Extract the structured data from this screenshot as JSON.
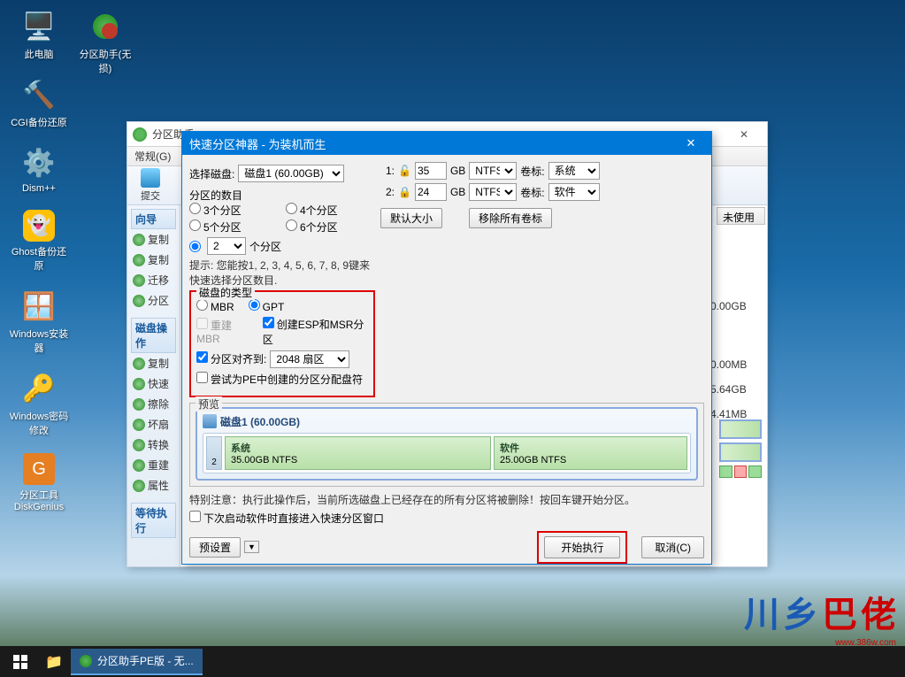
{
  "desktop": {
    "icons": [
      {
        "name": "this-pc",
        "label": "此电脑",
        "glyph": "🖥️"
      },
      {
        "name": "partition-assistant",
        "label": "分区助手(无损)",
        "glyph": "💿"
      },
      {
        "name": "cgi-backup",
        "label": "CGI备份还原",
        "glyph": "🔨"
      },
      {
        "name": "dism",
        "label": "Dism++",
        "glyph": "⚙️"
      },
      {
        "name": "ghost",
        "label": "Ghost备份还原",
        "glyph": "👻"
      },
      {
        "name": "windows-installer",
        "label": "Windows安装器",
        "glyph": "🪟"
      },
      {
        "name": "windows-password",
        "label": "Windows密码修改",
        "glyph": "🔑"
      },
      {
        "name": "diskgenius",
        "label": "分区工具DiskGenius",
        "glyph": "💾"
      }
    ]
  },
  "parent_window": {
    "title": "分区助手",
    "menu": {
      "general": "常规(G)"
    },
    "toolbar": {
      "submit": "提交"
    },
    "sidebar": {
      "wizard_title": "向导",
      "wizard_items": [
        "复制",
        "复制",
        "迁移",
        "分区"
      ],
      "disk_title": "磁盘操作",
      "disk_items": [
        "复制",
        "快速",
        "擦除",
        "坏扇",
        "转换",
        "重建",
        "属性"
      ],
      "pending_title": "等待执行"
    },
    "col_unused": "未使用",
    "info_rows": [
      "0.00GB",
      "0.00MB",
      "5.64GB",
      "4.41MB"
    ]
  },
  "dialog": {
    "title": "快速分区神器 - 为装机而生",
    "select_disk_label": "选择磁盘:",
    "select_disk_value": "磁盘1 (60.00GB)",
    "partition_count": {
      "label": "分区的数目",
      "opts": {
        "p3": "3个分区",
        "p4": "4个分区",
        "p5": "5个分区",
        "p6": "6个分区"
      },
      "custom_count": "2",
      "custom_unit": "个分区",
      "hint": "提示: 您能按1, 2, 3, 4, 5, 6, 7, 8, 9键来快速选择分区数目."
    },
    "disk_type": {
      "legend": "磁盘的类型",
      "mbr": "MBR",
      "gpt": "GPT",
      "rebuild_mbr": "重建MBR",
      "create_esp_msr": "创建ESP和MSR分区",
      "align_label": "分区对齐到:",
      "align_value": "2048 扇区",
      "assign_letter": "尝试为PE中创建的分区分配盘符"
    },
    "partitions": {
      "gb": "GB",
      "label_vol": "卷标:",
      "rows": [
        {
          "idx": "1:",
          "size": "35",
          "fs": "NTFS",
          "vol": "系统"
        },
        {
          "idx": "2:",
          "size": "24",
          "fs": "NTFS",
          "vol": "软件"
        }
      ],
      "default_size_btn": "默认大小",
      "remove_labels_btn": "移除所有卷标"
    },
    "preview": {
      "legend": "预览",
      "disk_title": "磁盘1 (60.00GB)",
      "side_num": "2",
      "parts": [
        {
          "name": "系统",
          "detail": "35.00GB NTFS"
        },
        {
          "name": "软件",
          "detail": "25.00GB NTFS"
        }
      ]
    },
    "footer": {
      "warning": "特别注意：执行此操作后，当前所选磁盘上已经存在的所有分区将被删除！按回车键开始分区。",
      "skip_dialog": "下次启动软件时直接进入快速分区窗口",
      "preset_btn": "预设置",
      "execute_btn": "开始执行",
      "cancel_btn": "取消(C)"
    }
  },
  "taskbar": {
    "task1": "分区助手PE版 - 无..."
  },
  "watermark": {
    "t1": "乡",
    "t2": "巴",
    "t3": "佬",
    "sub": "www.386w.com"
  }
}
